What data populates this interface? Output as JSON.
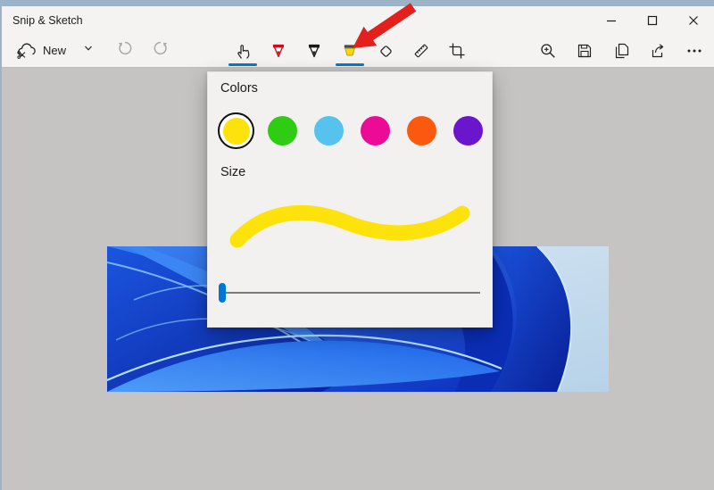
{
  "window": {
    "title": "Snip & Sketch"
  },
  "frame": {
    "strip_color": "#9db3c7"
  },
  "toolbar": {
    "new_label": "New",
    "accent_color": "#0078d7",
    "active_tools": [
      "touch-writing",
      "highlighter"
    ],
    "tool_names": [
      "touch-writing",
      "ballpoint-pen",
      "pencil",
      "highlighter",
      "eraser",
      "ruler",
      "crop"
    ],
    "right_action_names": [
      "zoom",
      "save",
      "copy",
      "share",
      "more-options"
    ]
  },
  "popup": {
    "colors_label": "Colors",
    "size_label": "Size",
    "swatches": [
      {
        "name": "yellow",
        "hex": "#fde30b",
        "selected": true
      },
      {
        "name": "green",
        "hex": "#2ecc12",
        "selected": false
      },
      {
        "name": "light-blue",
        "hex": "#55c3ee",
        "selected": false
      },
      {
        "name": "pink",
        "hex": "#eb0b95",
        "selected": false
      },
      {
        "name": "orange",
        "hex": "#fb5a0e",
        "selected": false
      },
      {
        "name": "purple",
        "hex": "#6a16cc",
        "selected": false
      }
    ],
    "stroke_preview_color": "#fde30b",
    "slider": {
      "thumb_color": "#0078d7",
      "value_percent": 0
    }
  },
  "annotation": {
    "arrow_color": "#e3201b"
  },
  "canvas": {
    "background": "#c5c4c3",
    "screenshot_subject": "windows-11-bloom-wallpaper"
  }
}
